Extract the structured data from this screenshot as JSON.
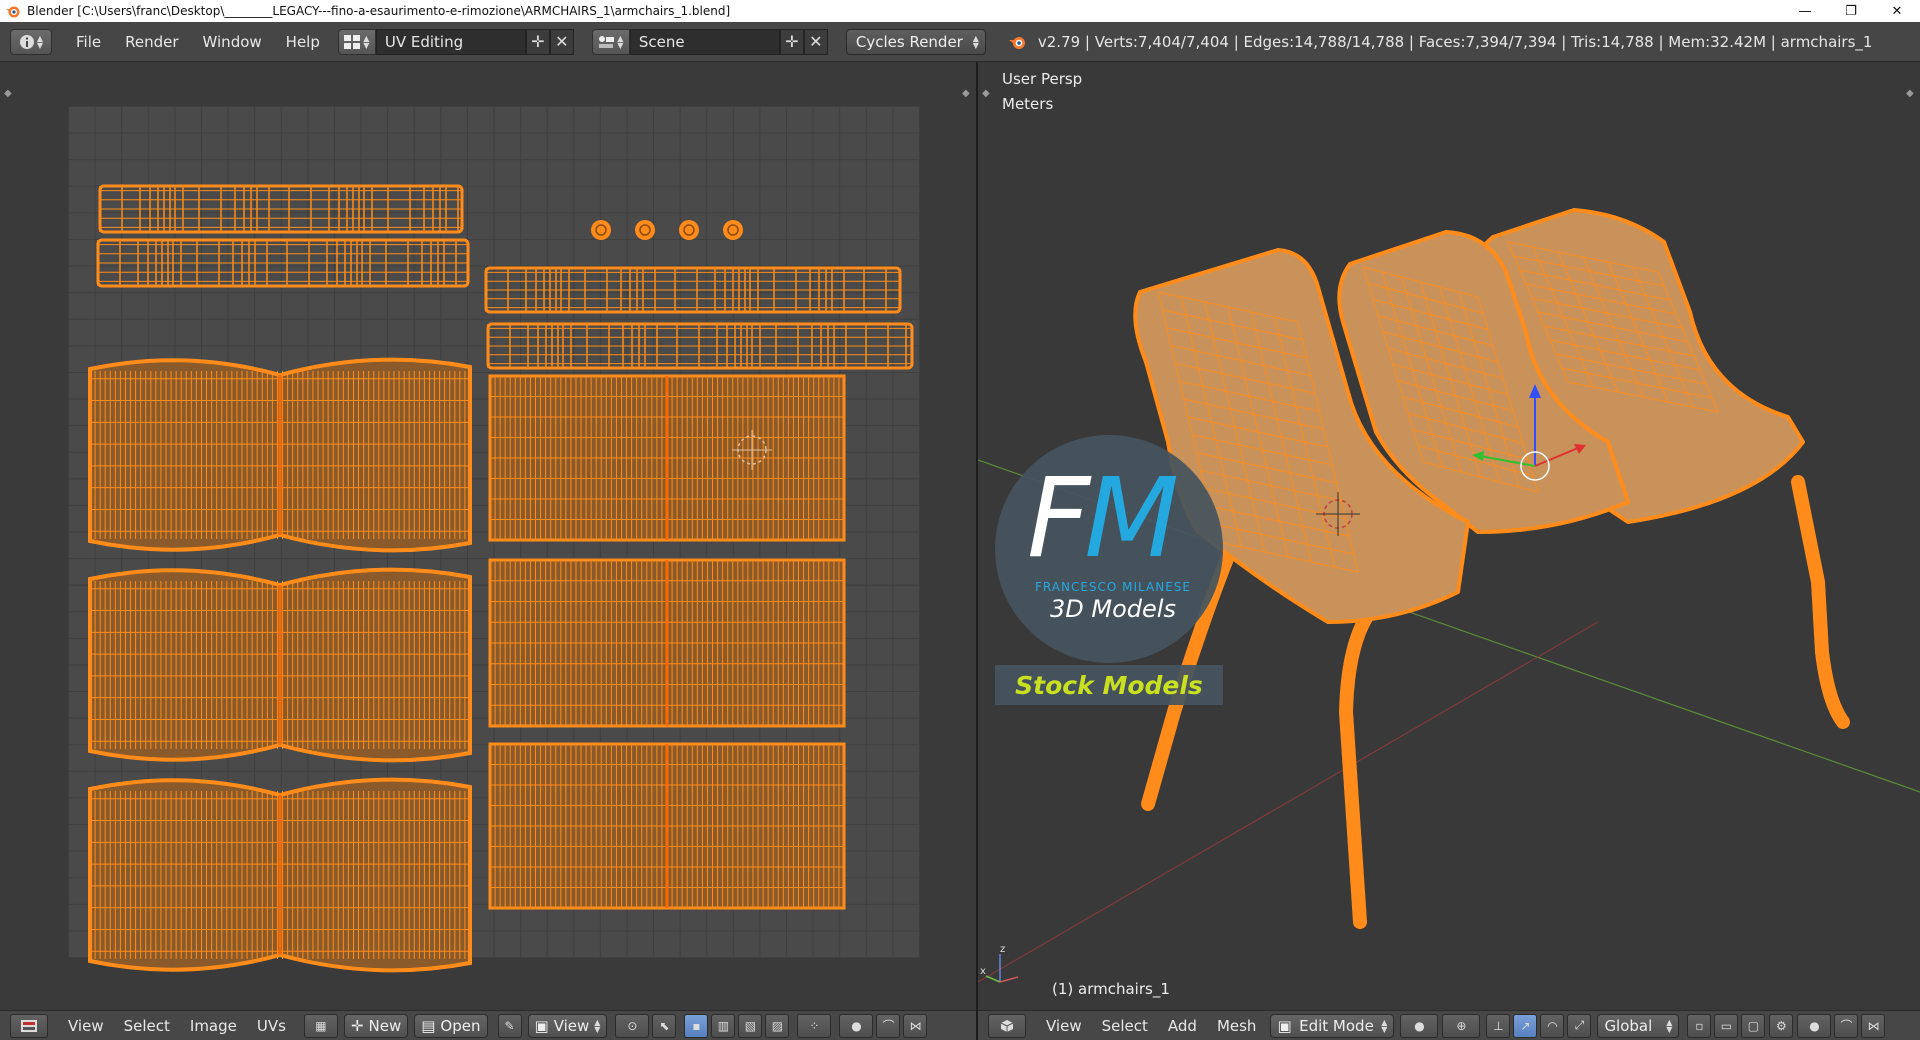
{
  "window": {
    "title": "Blender [C:\\Users\\franc\\Desktop\\________LEGACY---fino-a-esaurimento-e-rimozione\\ARMCHAIRS_1\\armchairs_1.blend]",
    "minimize": "—",
    "maximize": "❐",
    "close": "✕"
  },
  "info_header": {
    "menus": [
      "File",
      "Render",
      "Window",
      "Help"
    ],
    "screen_layout": "UV Editing",
    "scene": "Scene",
    "render_engine": "Cycles Render",
    "stats": "v2.79 | Verts:7,404/7,404 | Edges:14,788/14,788 | Faces:7,394/7,394 | Tris:14,788 | Mem:32.42M | armchairs_1"
  },
  "viewport": {
    "view_name": "User Persp",
    "units": "Meters",
    "object_label": "(1) armchairs_1",
    "axis_x": "x",
    "axis_z": "z"
  },
  "watermark": {
    "letter_f": "F",
    "letter_m": "M",
    "name": "FRANCESCO MILANESE",
    "subtitle": "3D Models",
    "tagline": "Stock Models"
  },
  "uv_footer": {
    "menus": [
      "View",
      "Select",
      "Image",
      "UVs"
    ],
    "new_label": "New",
    "open_label": "Open",
    "view_label": "View"
  },
  "view3d_footer": {
    "menus": [
      "View",
      "Select",
      "Add",
      "Mesh"
    ],
    "mode": "Edit Mode",
    "orientation": "Global"
  },
  "colors": {
    "wire_orange": "#ff8c1a",
    "face_orange": "#c9925a",
    "background": "#393939",
    "header": "#464646"
  },
  "icons": [
    "blender-icon",
    "info-icon",
    "layout-icon",
    "scene-icon",
    "add-icon",
    "close-icon",
    "pin-icon",
    "cursor-icon"
  ]
}
